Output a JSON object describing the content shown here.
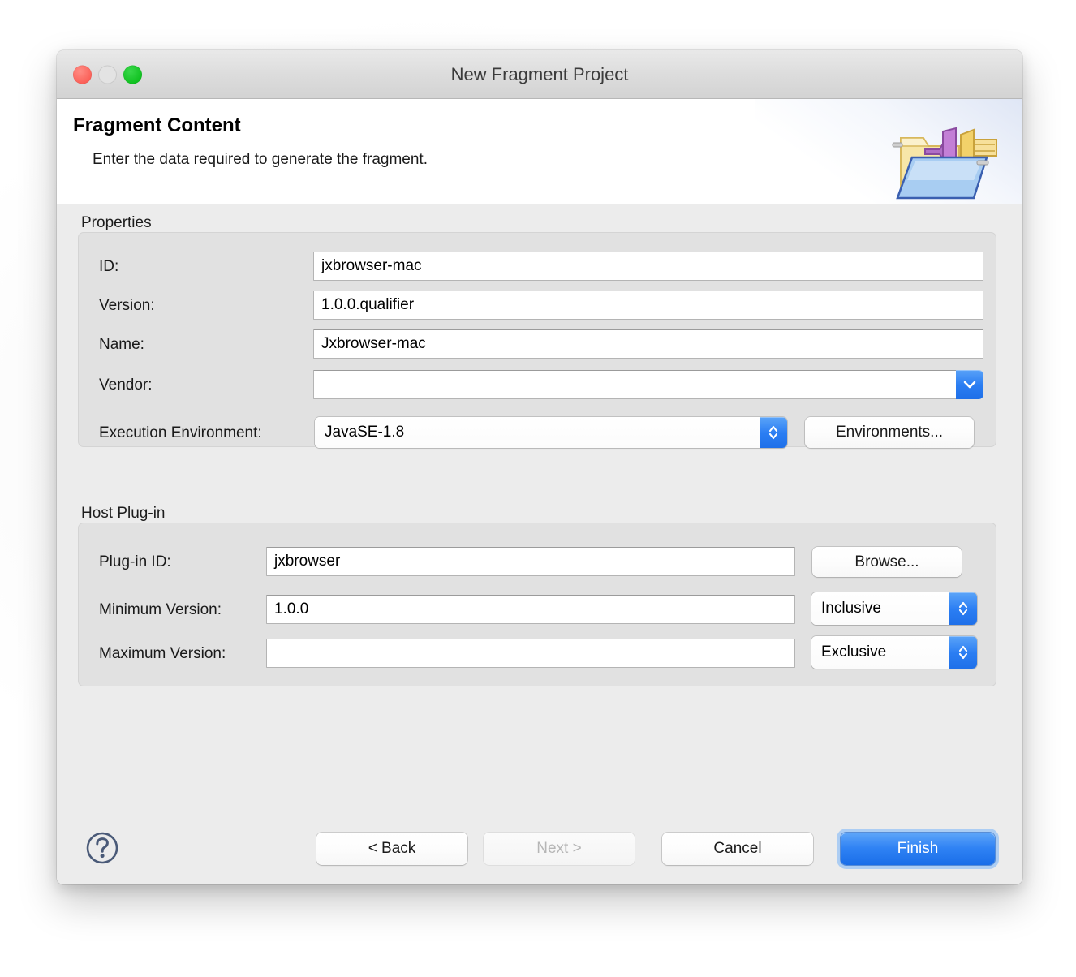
{
  "window": {
    "title": "New Fragment Project",
    "traffic_lights": [
      "close-button",
      "minimize-button",
      "zoom-button"
    ]
  },
  "banner": {
    "title": "Fragment Content",
    "subtitle": "Enter the data required to generate the fragment.",
    "icon": "fragment-wizard-icon"
  },
  "properties": {
    "group_label": "Properties",
    "fields": [
      {
        "label": "ID:",
        "value": "jxbrowser-mac",
        "type": "text"
      },
      {
        "label": "Version:",
        "value": "1.0.0.qualifier",
        "type": "text"
      },
      {
        "label": "Name:",
        "value": "Jxbrowser-mac",
        "type": "text"
      },
      {
        "label": "Vendor:",
        "value": "",
        "type": "combo"
      },
      {
        "label": "Execution Environment:",
        "value": "JavaSE-1.8",
        "type": "popup"
      }
    ],
    "environments_button": "Environments..."
  },
  "host_plugin": {
    "group_label": "Host Plug-in",
    "fields": [
      {
        "label": "Plug-in ID:",
        "value": "jxbrowser"
      },
      {
        "label": "Minimum Version:",
        "value": "1.0.0"
      },
      {
        "label": "Maximum Version:",
        "value": ""
      }
    ],
    "browse_button": "Browse...",
    "min_rule": "Inclusive",
    "max_rule": "Exclusive"
  },
  "footer": {
    "help": "help-icon",
    "back": "< Back",
    "next": "Next >",
    "cancel": "Cancel",
    "finish": "Finish"
  },
  "colors": {
    "accent": "#2a7df2",
    "window_bg": "#ececec",
    "group_bg": "#e1e1e1",
    "titlebar": "#dcdcdc",
    "close": "#fb5f57",
    "zoom": "#0fc01f",
    "minimize": "#e3e3e3"
  }
}
